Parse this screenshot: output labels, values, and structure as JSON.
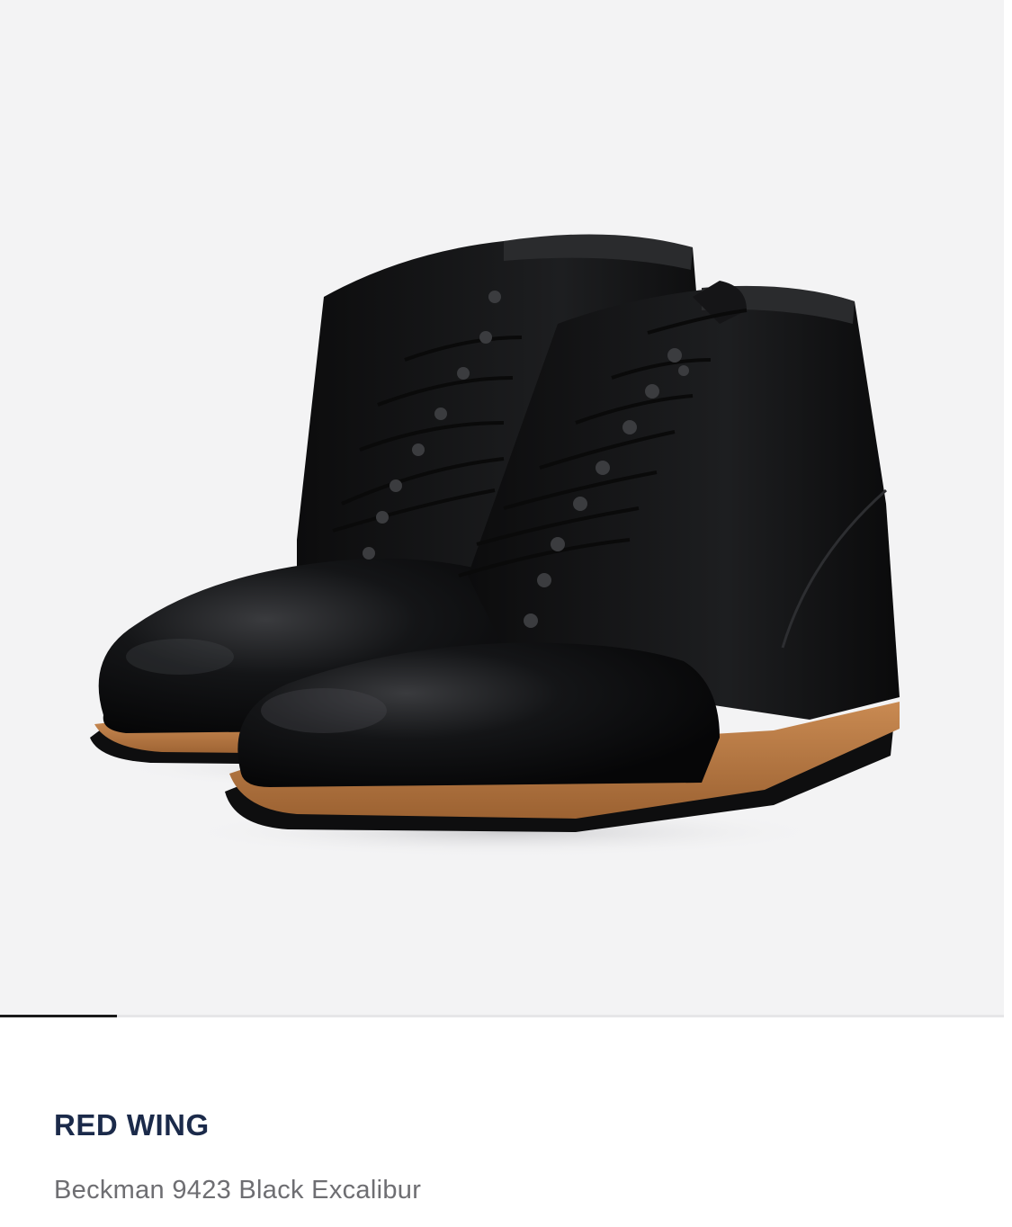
{
  "gallery": {
    "image_alt": "Black leather lace-up boots",
    "slide_progress": 0.116
  },
  "product": {
    "brand": "RED WING",
    "name": "Beckman 9423 Black Excalibur"
  },
  "colors": {
    "brand_text": "#1b2a4a",
    "name_text": "#6e6e72",
    "image_bg": "#f3f3f4"
  }
}
